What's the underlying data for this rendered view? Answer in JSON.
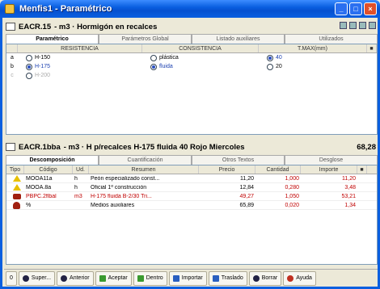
{
  "window": {
    "title": "Menfis1 - Paramétrico"
  },
  "window_controls": [
    "_",
    "□",
    "×"
  ],
  "top_panel": {
    "code": "EACR.15",
    "title": "- m3 · Hormigón en recalces",
    "tabs": [
      "Paramétrico",
      "Parámetros Global",
      "Listado auxiliares",
      "Utilizados"
    ],
    "columns": [
      "RESISTENCIA",
      "CONSISTENCIA",
      "T.MAX(mm)"
    ],
    "rows": [
      {
        "key": "a",
        "resistencia": "H-150",
        "consistencia": "plástica",
        "tmax": "40",
        "res_on": false,
        "con_on": false,
        "tmax_on": true,
        "dim": false
      },
      {
        "key": "b",
        "resistencia": "H-175",
        "consistencia": "fluida",
        "tmax": "20",
        "res_on": true,
        "con_on": true,
        "tmax_on": false,
        "dim": false
      },
      {
        "key": "c",
        "resistencia": "H-200",
        "consistencia": "",
        "tmax": "",
        "res_on": false,
        "con_on": false,
        "tmax_on": false,
        "dim": true
      }
    ]
  },
  "bottom_panel": {
    "code": "EACR.1bba",
    "title": "- m3 · H p/recalces H-175 fluida 40 Rojo Miercoles",
    "total": "68,28",
    "tabs": [
      "Descomposición",
      "Cuantificación",
      "Otros Textos",
      "Desglose"
    ],
    "columns": [
      "Tipo",
      "Código",
      "Ud.",
      "Resumen",
      "Precio",
      "Cantidad",
      "Importe"
    ],
    "rows": [
      {
        "icon": "warning",
        "codigo": "MOOA11a",
        "ud": "h",
        "resumen": "Peón especializado const...",
        "precio": "11,20",
        "cantidad": "1,000",
        "importe": "11,20",
        "red": false
      },
      {
        "icon": "warning",
        "codigo": "MOOA.8a",
        "ud": "h",
        "resumen": "Oficial 1ª construcción",
        "precio": "12,84",
        "cantidad": "0,280",
        "importe": "3,48",
        "red": false
      },
      {
        "icon": "material",
        "codigo": "PBPC.2flbal",
        "ud": "m3",
        "resumen": "H-175 fluida B-2/30 Tri...",
        "precio": "49,27",
        "cantidad": "1,050",
        "importe": "53,21",
        "red": true
      },
      {
        "icon": "aux",
        "codigo": "%",
        "ud": "",
        "resumen": "Medios auxiliares",
        "precio": "65,89",
        "cantidad": "0,020",
        "importe": "1,34",
        "red": false
      }
    ]
  },
  "toolbar": {
    "buttons": [
      "0",
      "Super...",
      "Anterior",
      "Aceptar",
      "Dentro",
      "Importar",
      "Traslado",
      "Borrar",
      "Ayuda"
    ]
  }
}
